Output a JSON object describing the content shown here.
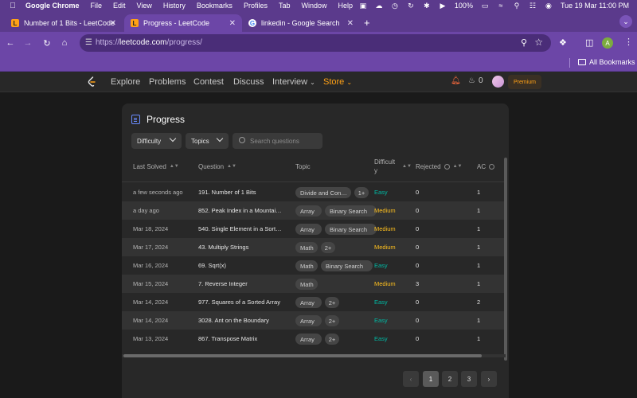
{
  "mac_menu": {
    "app_name": "Google Chrome",
    "items": [
      "File",
      "Edit",
      "View",
      "History",
      "Bookmarks",
      "Profiles",
      "Tab",
      "Window",
      "Help"
    ],
    "battery": "100%",
    "clock": "Tue 19 Mar  11:00 PM"
  },
  "tabs": [
    {
      "title": "Number of 1 Bits - LeetCode",
      "active": false
    },
    {
      "title": "Progress - LeetCode",
      "active": true
    },
    {
      "title": "linkedin - Google Search",
      "active": false
    }
  ],
  "address": {
    "scheme": "https://",
    "host": "leetcode.com",
    "path": "/progress/"
  },
  "bookmarks": {
    "all_label": "All Bookmarks"
  },
  "profile": {
    "initial": "A"
  },
  "lc_nav": {
    "links": [
      "Explore",
      "Problems",
      "Contest",
      "Discuss"
    ],
    "interview": "Interview",
    "store": "Store",
    "streak": "0",
    "premium": "Premium"
  },
  "colors": {
    "accent": "#ffa116",
    "easy": "#00b8a3",
    "medium": "#ffc01e",
    "chrome": "#6c46a7"
  },
  "progress": {
    "title": "Progress",
    "filters": {
      "difficulty": "Difficulty",
      "topics": "Topics",
      "search_placeholder": "Search questions"
    },
    "columns": {
      "last_solved": "Last Solved",
      "question": "Question",
      "topic": "Topic",
      "difficulty": "Difficult\ny",
      "rejected": "Rejected",
      "ac": "AC"
    },
    "rows": [
      {
        "last": "a few seconds ago",
        "question": "191. Number of 1 Bits",
        "topics": [
          "Divide and Con…",
          "1+"
        ],
        "difficulty": "Easy",
        "rejected": "0",
        "ac": "1"
      },
      {
        "last": "a day ago",
        "question": "852. Peak Index in a Mountai…",
        "topics": [
          "Array",
          "Binary Search"
        ],
        "difficulty": "Medium",
        "rejected": "0",
        "ac": "1"
      },
      {
        "last": "Mar 18, 2024",
        "question": "540. Single Element in a Sort…",
        "topics": [
          "Array",
          "Binary Search"
        ],
        "difficulty": "Medium",
        "rejected": "0",
        "ac": "1"
      },
      {
        "last": "Mar 17, 2024",
        "question": "43. Multiply Strings",
        "topics": [
          "Math",
          "2+"
        ],
        "difficulty": "Medium",
        "rejected": "0",
        "ac": "1"
      },
      {
        "last": "Mar 16, 2024",
        "question": "69. Sqrt(x)",
        "topics": [
          "Math",
          "Binary Search"
        ],
        "difficulty": "Easy",
        "rejected": "0",
        "ac": "1"
      },
      {
        "last": "Mar 15, 2024",
        "question": "7. Reverse Integer",
        "topics": [
          "Math"
        ],
        "difficulty": "Medium",
        "rejected": "3",
        "ac": "1"
      },
      {
        "last": "Mar 14, 2024",
        "question": "977. Squares of a Sorted Array",
        "topics": [
          "Array",
          "2+"
        ],
        "difficulty": "Easy",
        "rejected": "0",
        "ac": "2"
      },
      {
        "last": "Mar 14, 2024",
        "question": "3028. Ant on the Boundary",
        "topics": [
          "Array",
          "2+"
        ],
        "difficulty": "Easy",
        "rejected": "0",
        "ac": "1"
      },
      {
        "last": "Mar 13, 2024",
        "question": "867. Transpose Matrix",
        "topics": [
          "Array",
          "2+"
        ],
        "difficulty": "Easy",
        "rejected": "0",
        "ac": "1"
      }
    ],
    "pages": [
      "1",
      "2",
      "3"
    ],
    "current_page": "1"
  }
}
